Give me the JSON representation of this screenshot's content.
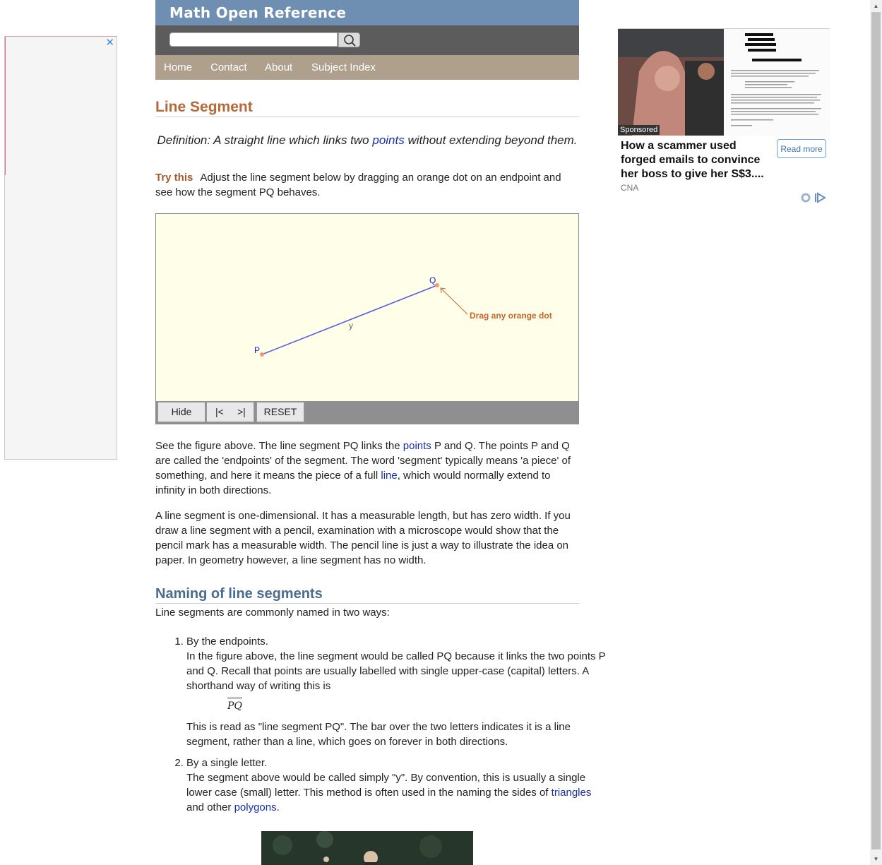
{
  "header": {
    "title": "Math Open Reference",
    "search_value": ""
  },
  "nav": [
    "Home",
    "Contact",
    "About",
    "Subject Index"
  ],
  "page_title": "Line Segment",
  "definition": {
    "before": "Definition: A straight line which links two ",
    "link": "points",
    "after": " without extending beyond them."
  },
  "try_this": {
    "label": "Try this",
    "text": "Adjust the line segment below by dragging an orange dot on an endpoint and see how the segment PQ behaves."
  },
  "applet": {
    "point_p": "P",
    "point_q": "Q",
    "segment_label": "y",
    "hint": "Drag any orange dot",
    "buttons": {
      "hide": "Hide",
      "prev": "|<",
      "next": ">|",
      "reset": "RESET"
    },
    "colors": {
      "segment": "#5a5ae6",
      "accent": "#c8642c",
      "background": "#ffffe9"
    }
  },
  "para1": {
    "t1": "See the figure above. The line segment PQ links the ",
    "l1": "points",
    "t2": " P and Q. The points P and Q are called the 'endpoints' of the segment. The word 'segment' typically means 'a piece' of something, and here it means the piece of a full ",
    "l2": "line",
    "t3": ", which would normally extend to infinity in both directions."
  },
  "para2": "A line segment is one-dimensional. It has a measurable length, but has zero width. If you draw a line segment with a pencil, examination with a microscope would show that the pencil mark has a measurable width. The pencil line is just a way to illustrate the idea on paper. In geometry however, a line segment has no width.",
  "naming": {
    "heading": "Naming of line segments",
    "intro": "Line segments are commonly named in two ways:",
    "item1": {
      "title": "By the endpoints.",
      "text": "In the figure above, the line segment would be called PQ because it links the two points P and Q. Recall that points are usually labelled with single upper-case (capital) letters. A shorthand way of writing this is",
      "notation": "PQ",
      "after": "This is read as \"line segment PQ\".  The bar over the two letters indicates it is a line segment, rather than a line, which goes on forever in both directions."
    },
    "item2": {
      "title": "By a single letter.",
      "text": "The segment above would be called simply \"y\". By convention, this is usually a single lower case (small) letter. This method is often used in the naming the sides of ",
      "link1": "triangles",
      "mid": " and other ",
      "link2": "polygons",
      "end": "."
    }
  },
  "ad": {
    "sponsored": "Sponsored",
    "headline": "How a scammer used forged emails to convince her boss to give her S$3....",
    "source": "CNA",
    "cta": "Read more"
  },
  "left_ad": {
    "close_icon": "close-icon"
  }
}
